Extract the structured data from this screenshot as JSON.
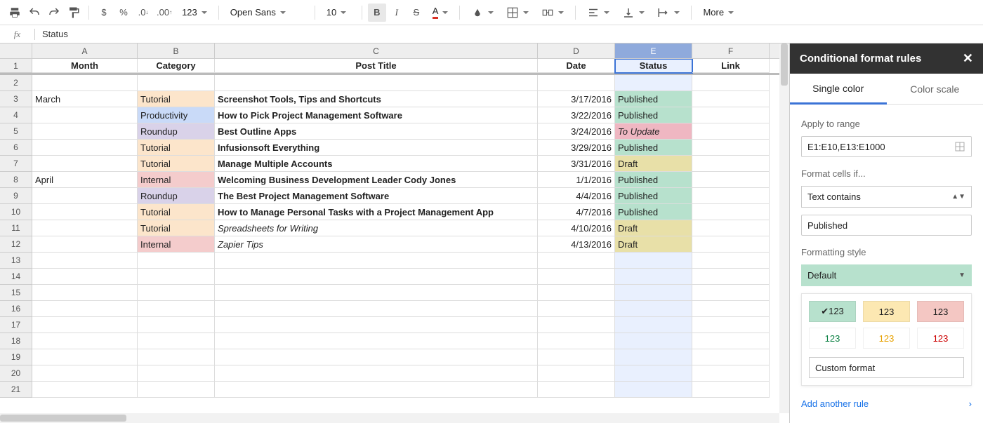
{
  "toolbar": {
    "font": "Open Sans",
    "size": "10",
    "more": "More"
  },
  "fx": {
    "value": "Status"
  },
  "columns": [
    "A",
    "B",
    "C",
    "D",
    "E",
    "F"
  ],
  "headers": {
    "A": "Month",
    "B": "Category",
    "C": "Post Title",
    "D": "Date",
    "E": "Status",
    "F": "Link"
  },
  "rows": [
    {
      "n": 1,
      "header": true
    },
    {
      "n": 2
    },
    {
      "n": 3,
      "A": "March",
      "B": "Tutorial",
      "Bc": "f-tut",
      "C": "Screenshot Tools, Tips and Shortcuts",
      "Cb": true,
      "D": "3/17/2016",
      "E": "Published",
      "Ec": "f-pub"
    },
    {
      "n": 4,
      "B": "Productivity",
      "Bc": "f-prod",
      "C": "How to Pick Project Management Software",
      "Cb": true,
      "D": "3/22/2016",
      "E": "Published",
      "Ec": "f-pub"
    },
    {
      "n": 5,
      "B": "Roundup",
      "Bc": "f-round",
      "C": "Best Outline Apps",
      "Cb": true,
      "D": "3/24/2016",
      "E": "To Update",
      "Ec": "f-upd",
      "Ei": true
    },
    {
      "n": 6,
      "B": "Tutorial",
      "Bc": "f-tut",
      "C": "Infusionsoft Everything",
      "Cb": true,
      "D": "3/29/2016",
      "E": "Published",
      "Ec": "f-pub"
    },
    {
      "n": 7,
      "B": "Tutorial",
      "Bc": "f-tut",
      "C": "Manage Multiple Accounts",
      "Cb": true,
      "D": "3/31/2016",
      "E": "Draft",
      "Ec": "f-draft"
    },
    {
      "n": 8,
      "A": "April",
      "B": "Internal",
      "Bc": "f-int",
      "C": "Welcoming Business Development Leader Cody Jones",
      "Cb": true,
      "D": "1/1/2016",
      "E": "Published",
      "Ec": "f-pub"
    },
    {
      "n": 9,
      "B": "Roundup",
      "Bc": "f-round",
      "C": "The Best Project Management Software",
      "Cb": true,
      "D": "4/4/2016",
      "E": "Published",
      "Ec": "f-pub"
    },
    {
      "n": 10,
      "B": "Tutorial",
      "Bc": "f-tut",
      "C": "How to Manage Personal Tasks with a Project Management App",
      "Cb": true,
      "D": "4/7/2016",
      "E": "Published",
      "Ec": "f-pub"
    },
    {
      "n": 11,
      "B": "Tutorial",
      "Bc": "f-tut",
      "C": "Spreadsheets for Writing",
      "Ci": true,
      "D": "4/10/2016",
      "E": "Draft",
      "Ec": "f-draft"
    },
    {
      "n": 12,
      "B": "Internal",
      "Bc": "f-int",
      "C": "Zapier Tips",
      "Ci": true,
      "D": "4/13/2016",
      "E": "Draft",
      "Ec": "f-draft"
    },
    {
      "n": 13
    },
    {
      "n": 14
    },
    {
      "n": 15
    },
    {
      "n": 16
    },
    {
      "n": 17
    },
    {
      "n": 18
    },
    {
      "n": 19
    },
    {
      "n": 20
    },
    {
      "n": 21
    }
  ],
  "panel": {
    "title": "Conditional format rules",
    "tab1": "Single color",
    "tab2": "Color scale",
    "apply_label": "Apply to range",
    "range": "E1:E10,E13:E1000",
    "format_if": "Format cells if...",
    "condition": "Text contains",
    "value": "Published",
    "style_label": "Formatting style",
    "style_val": "Default",
    "sw_check": "✔123",
    "sw": "123",
    "custom": "Custom format",
    "add": "Add another rule"
  }
}
